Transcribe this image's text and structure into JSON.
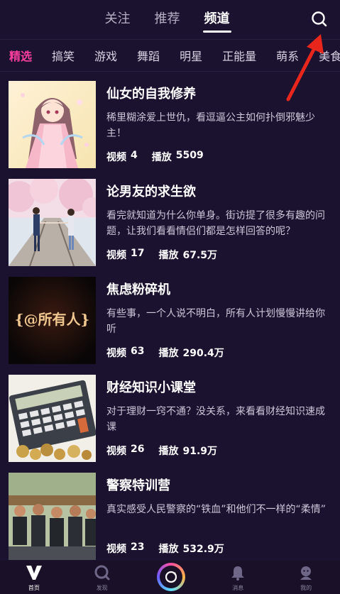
{
  "top_tabs": [
    {
      "label": "关注",
      "active": false
    },
    {
      "label": "推荐",
      "active": false
    },
    {
      "label": "频道",
      "active": true
    }
  ],
  "categories": [
    "精选",
    "搞笑",
    "游戏",
    "舞蹈",
    "明星",
    "正能量",
    "萌系",
    "美食"
  ],
  "active_category": "精选",
  "items": [
    {
      "title": "仙女的自我修养",
      "desc": "稀里糊涂爱上世仇，看逗逼公主如何扑倒邪魅少主！",
      "video_label": "视频",
      "video_count": "4",
      "play_label": "播放",
      "play_count": "5509"
    },
    {
      "title": "论男友的求生欲",
      "desc": "看完就知道为什么你单身。街访提了很多有趣的问题，让我们看看情侣们都是怎样回答的呢？",
      "video_label": "视频",
      "video_count": "17",
      "play_label": "播放",
      "play_count": "67.5万"
    },
    {
      "title": "焦虑粉碎机",
      "desc": "有些事，一个人说不明白，所有人计划慢慢讲给你听",
      "video_label": "视频",
      "video_count": "63",
      "play_label": "播放",
      "play_count": "290.4万"
    },
    {
      "title": "财经知识小课堂",
      "desc": "对于理财一窍不通？没关系，来看看财经知识速成课",
      "video_label": "视频",
      "video_count": "26",
      "play_label": "播放",
      "play_count": "91.9万"
    },
    {
      "title": "警察特训营",
      "desc": "真实感受人民警察的“铁血”和他们不一样的“柔情”",
      "video_label": "视频",
      "video_count": "23",
      "play_label": "播放",
      "play_count": "532.9万"
    }
  ],
  "thumb3_text": "{@所有人}",
  "bottom_nav": [
    {
      "label": "首页",
      "icon": "v-logo-icon",
      "active": true
    },
    {
      "label": "发现",
      "icon": "discover-icon",
      "active": false
    },
    {
      "label": "",
      "icon": "camera-icon",
      "active": false
    },
    {
      "label": "消息",
      "icon": "bell-icon",
      "active": false
    },
    {
      "label": "我的",
      "icon": "profile-icon",
      "active": false
    }
  ],
  "colors": {
    "background": "#1b1230",
    "accent": "#ff3fa0",
    "annotation_arrow": "#e8261c"
  }
}
